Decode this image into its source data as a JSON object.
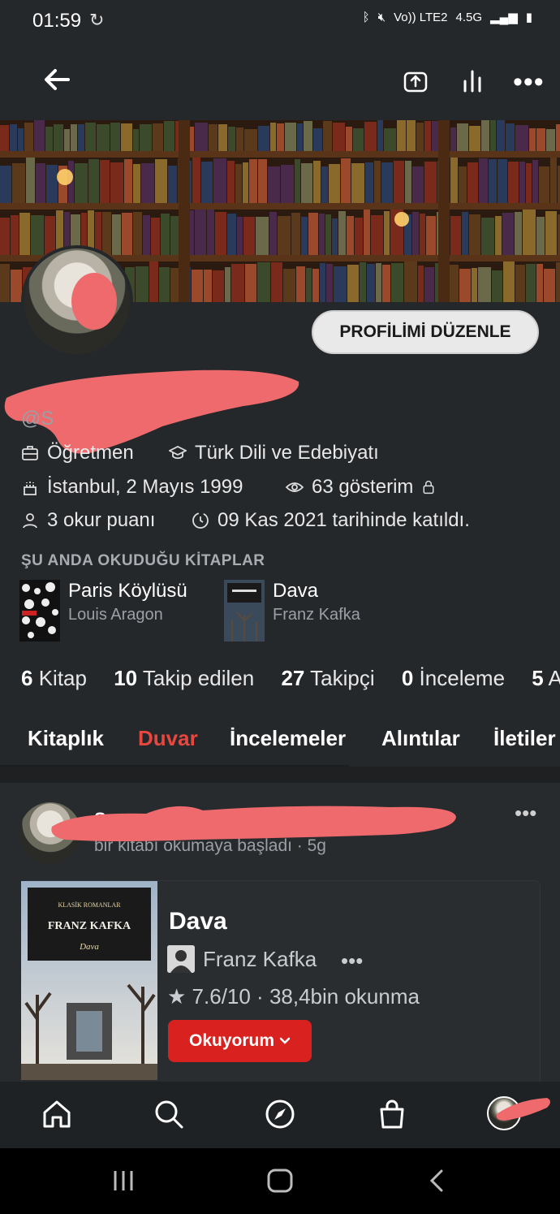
{
  "status_bar": {
    "time": "01:59",
    "network": "Vo)) LTE2",
    "network_type": "4.5G"
  },
  "profile": {
    "edit_button": "PROFİLİMİ DÜZENLE",
    "handle": "@S",
    "occupation": "Öğretmen",
    "department": "Türk Dili ve Edebiyatı",
    "birth": "İstanbul, 2 Mayıs 1999",
    "views": "63 gösterim",
    "points": "3 okur puanı",
    "joined": "09 Kas 2021 tarihinde katıldı."
  },
  "currently_reading": {
    "title": "ŞU ANDA OKUDUĞU KİTAPLAR",
    "books": [
      {
        "title": "Paris Köylüsü",
        "author": "Louis Aragon"
      },
      {
        "title": "Dava",
        "author": "Franz Kafka"
      }
    ]
  },
  "stats": [
    {
      "count": "6",
      "label": "Kitap"
    },
    {
      "count": "10",
      "label": "Takip edilen"
    },
    {
      "count": "27",
      "label": "Takipçi"
    },
    {
      "count": "0",
      "label": "İnceleme"
    },
    {
      "count": "5",
      "label": "A"
    }
  ],
  "tabs": [
    "Kitaplık",
    "Duvar",
    "İncelemeler",
    "Alıntılar",
    "İletiler"
  ],
  "active_tab": "Duvar",
  "post": {
    "name": "Sevr",
    "subtitle": "bir kitabı okumaya başladı · 5g",
    "book_cover_series": "KLASİK ROMANLAR",
    "book_cover_author": "FRANZ KAFKA",
    "book_cover_title": "Dava",
    "book_title": "Dava",
    "book_author": "Franz Kafka",
    "rating": "7.6/10 · 38,4bin okunma",
    "status_button": "Okuyorum"
  },
  "colors": {
    "accent": "#e8473f",
    "button_red": "#d9211f",
    "background": "#25282b",
    "redaction": "#ef6a6c"
  }
}
